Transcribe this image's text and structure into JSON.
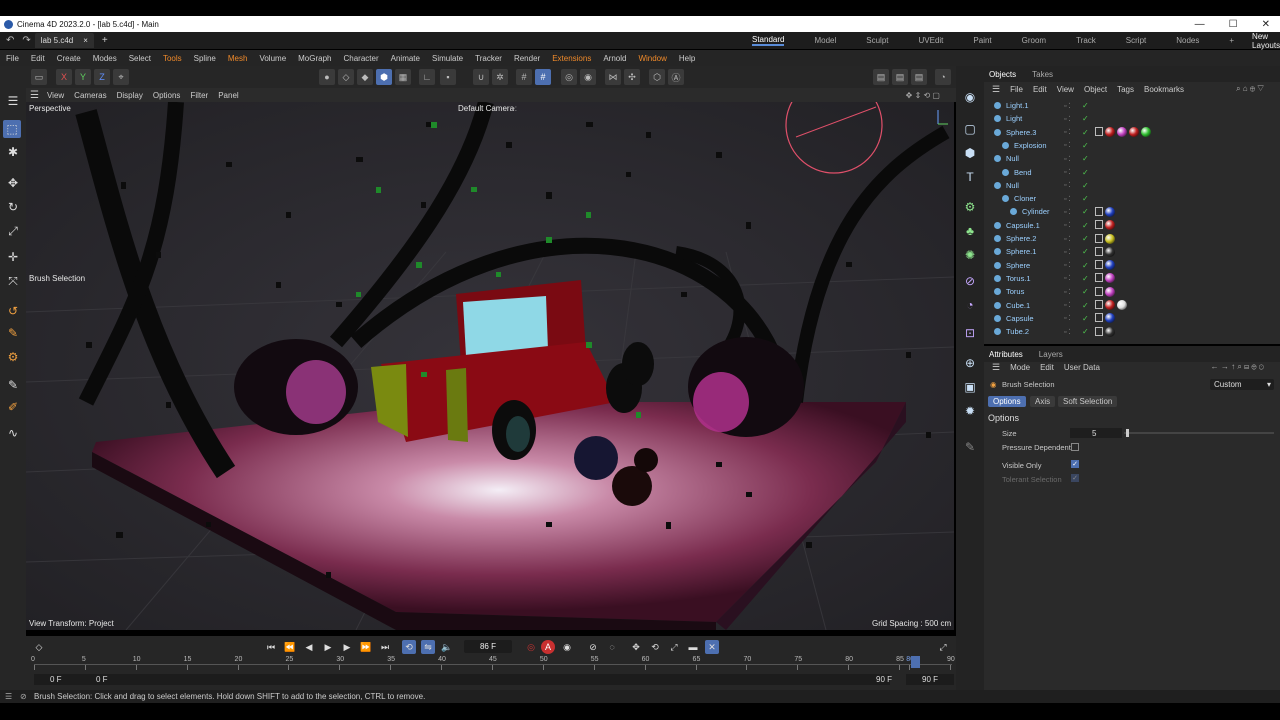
{
  "window": {
    "title": "Cinema 4D 2023.2.0 - [lab 5.c4d] - Main"
  },
  "doc_tab": {
    "label": "lab 5.c4d",
    "close": "×",
    "add": "+"
  },
  "layouts": {
    "items": [
      "Standard",
      "Model",
      "Sculpt",
      "UVEdit",
      "Paint",
      "Groom",
      "Track",
      "Script",
      "Nodes",
      "+"
    ],
    "new_layouts": "New Layouts"
  },
  "menubar": {
    "items": [
      "File",
      "Edit",
      "Create",
      "Modes",
      "Select",
      "Tools",
      "Spline",
      "Mesh",
      "Volume",
      "MoGraph",
      "Character",
      "Animate",
      "Simulate",
      "Tracker",
      "Render",
      "Extensions",
      "Arnold",
      "Window",
      "Help"
    ]
  },
  "toolbar": {
    "axes": [
      "X",
      "Y",
      "Z"
    ]
  },
  "viewport_menu": {
    "items": [
      "View",
      "Cameras",
      "Display",
      "Options",
      "Filter",
      "Panel"
    ]
  },
  "viewport": {
    "view_name": "Perspective",
    "camera": "Default Camera",
    "camera_suffix": "•:",
    "tool_label": "Brush Selection",
    "view_transform": "View Transform: Project",
    "grid_spacing": "Grid Spacing : 500 cm"
  },
  "timeline": {
    "current_frame": "86 F",
    "ruler_ticks": [
      "0",
      "5",
      "10",
      "15",
      "20",
      "25",
      "30",
      "35",
      "40",
      "45",
      "50",
      "55",
      "60",
      "65",
      "70",
      "75",
      "80",
      "85",
      "86",
      "90"
    ],
    "start_field": "0 F",
    "min_field": "0 F",
    "max_field": "90 F",
    "end_field": "90 F",
    "record_key": "A"
  },
  "status": {
    "text": "Brush Selection: Click and drag to select elements. Hold down SHIFT to add to the selection, CTRL to remove."
  },
  "objects_panel": {
    "tabs": [
      "Objects",
      "Takes"
    ],
    "menu": [
      "File",
      "Edit",
      "View",
      "Object",
      "Tags",
      "Bookmarks"
    ],
    "rows": [
      {
        "name": "Light.1",
        "tags": []
      },
      {
        "name": "Light",
        "tags": []
      },
      {
        "name": "Sphere.3",
        "tags": [
          "#c02020",
          "#c040c0",
          "#c02020",
          "#30c030"
        ]
      },
      {
        "name": "Explosion",
        "tags": []
      },
      {
        "name": "Null",
        "tags": []
      },
      {
        "name": "Bend",
        "tags": []
      },
      {
        "name": "Null",
        "tags": []
      },
      {
        "name": "Cloner",
        "tags": []
      },
      {
        "name": "Cylinder",
        "tags": [
          "#2040c0"
        ]
      },
      {
        "name": "Capsule.1",
        "tags": [
          "#c02020"
        ]
      },
      {
        "name": "Sphere.2",
        "tags": [
          "#c8c020"
        ]
      },
      {
        "name": "Sphere.1",
        "tags": [
          "#303030"
        ]
      },
      {
        "name": "Sphere",
        "tags": [
          "#2040c0"
        ]
      },
      {
        "name": "Torus.1",
        "tags": [
          "#c040c0"
        ]
      },
      {
        "name": "Torus",
        "tags": [
          "#c040c0"
        ]
      },
      {
        "name": "Cube.1",
        "tags": [
          "#c02020",
          "#e0e0e0"
        ]
      },
      {
        "name": "Capsule",
        "tags": [
          "#2040c0"
        ]
      },
      {
        "name": "Tube.2",
        "tags": [
          "#303030"
        ]
      }
    ]
  },
  "attributes_panel": {
    "tabs": [
      "Attributes",
      "Layers"
    ],
    "menu": [
      "Mode",
      "Edit",
      "User Data"
    ],
    "tool": "Brush Selection",
    "preset": "Custom",
    "subtabs": [
      "Options",
      "Axis",
      "Soft Selection"
    ],
    "section": "Options",
    "size_label": "Size",
    "size_value": "5",
    "pressure_label": "Pressure Dependent",
    "visible_only_label": "Visible Only",
    "tolerant_label": "Tolerant Selection",
    "pressure_checked": false,
    "visible_only_checked": true,
    "tolerant_checked": true
  }
}
